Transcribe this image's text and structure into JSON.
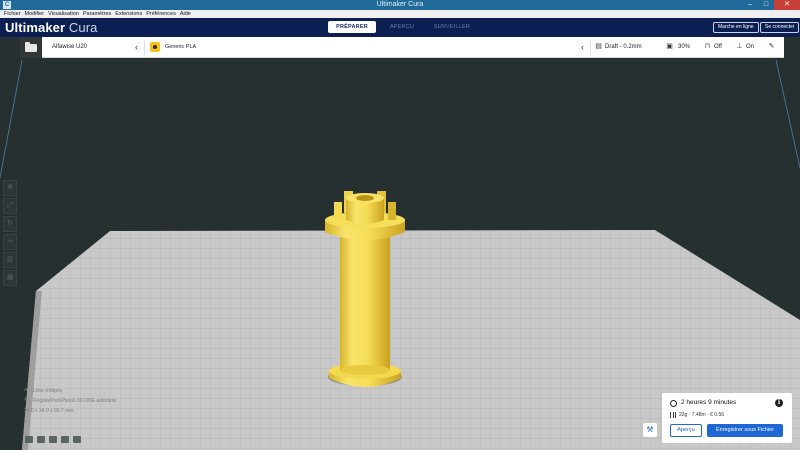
{
  "window": {
    "title": "Ultimaker Cura",
    "minimize": "–",
    "maximize": "□",
    "close": "✕"
  },
  "menu": [
    "Fichier",
    "Modifier",
    "Visualisation",
    "Paramètres",
    "Extensions",
    "Préférences",
    "Aide"
  ],
  "header": {
    "brand_bold": "Ultimaker",
    "brand_light": "Cura",
    "stages": [
      {
        "label": "PRÉPARER",
        "active": true
      },
      {
        "label": "APERÇU",
        "active": false
      },
      {
        "label": "SURVEILLER",
        "active": false
      }
    ],
    "marketplace_label": "Marche en ligne",
    "signin_label": "Se connecter"
  },
  "toolbar": {
    "printer": "Alfawise U20",
    "material": "Generic PLA",
    "profile": "Draft - 0.2mm",
    "infill": "30%",
    "support": "Off",
    "adhesion": "On"
  },
  "object_info": {
    "list_label": "Liste d'objets",
    "object_name": "RegularPackPieceL00-ONE.autodesk",
    "dimensions": "34.0 x 34.0 x 90.7 mm"
  },
  "print": {
    "time": "2 heures 9 minutes",
    "material_usage": "22g · 7.48m · € 0.56",
    "preview_label": "Aperçu",
    "save_label": "Enregistrer sous Fichier"
  },
  "colors": {
    "header_bg": "#0b1f53",
    "accent_blue": "#1f67d3",
    "model_yellow": "#f5dd5c",
    "viewport_bg": "#263031",
    "plate": "#c8c8c8"
  }
}
